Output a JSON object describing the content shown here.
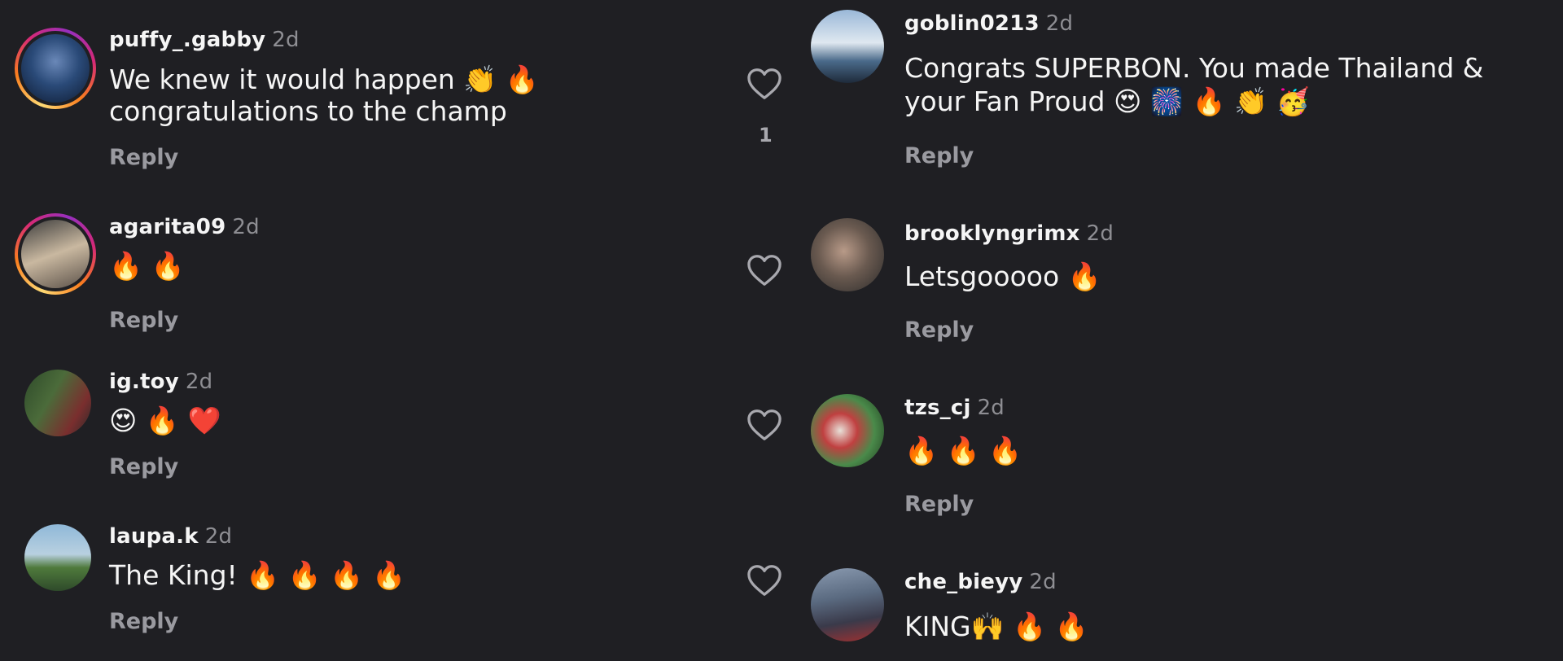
{
  "comments_left": [
    {
      "username": "puffy_.gabby",
      "time": "2d",
      "line1": "We knew it would happen 👏 🔥",
      "line2": "congratulations to the champ",
      "reply": "Reply",
      "avatar_colors": [
        "#2a4a78",
        "#0e1a30"
      ]
    },
    {
      "username": "agarita09",
      "time": "2d",
      "line1": "🔥 🔥",
      "line2": "",
      "reply": "Reply",
      "avatar_colors": [
        "#c9b8a0",
        "#3b3b3b"
      ]
    },
    {
      "username": "ig.toy",
      "time": "2d",
      "line1": "😍 🔥 ❤️",
      "line2": "",
      "reply": "Reply",
      "avatar_colors": [
        "#4b6b3a",
        "#7a2e2e"
      ]
    },
    {
      "username": "laupa.k",
      "time": "2d",
      "line1": "The King! 🔥 🔥 🔥 🔥",
      "line2": "",
      "reply": "Reply",
      "avatar_colors": [
        "#8fb8d8",
        "#4f7a3c"
      ]
    }
  ],
  "comments_right": [
    {
      "username": "goblin0213",
      "time": "2d",
      "line1": "Congrats SUPERBON. You made Thailand &",
      "line2": "your Fan Proud 😍 🎆 🔥 👏 🥳",
      "reply": "Reply",
      "likes": "1",
      "avatar_colors": [
        "#dfe8f0",
        "#4a6a8a"
      ]
    },
    {
      "username": "brooklyngrimx",
      "time": "2d",
      "line1": "Letsgooooo 🔥",
      "line2": "",
      "reply": "Reply",
      "likes": "",
      "avatar_colors": [
        "#6a5a50",
        "#2a2a2a"
      ]
    },
    {
      "username": "tzs_cj",
      "time": "2d",
      "line1": "🔥 🔥 🔥",
      "line2": "",
      "reply": "Reply",
      "likes": "",
      "avatar_colors": [
        "#4a8a4a",
        "#e8e0d8"
      ]
    },
    {
      "username": "che_bieyy",
      "time": "2d",
      "line1": "KING🙌 🔥 🔥",
      "line2": "",
      "reply": "Reply",
      "likes": "",
      "avatar_colors": [
        "#8a9ab0",
        "#3a3a4a"
      ]
    }
  ],
  "colors": {
    "background": "#1f1f23",
    "text": "#f5f5f5",
    "muted": "#8e8e93",
    "reply": "#9a9aa0"
  },
  "icons": {
    "like": "heart-outline-icon"
  }
}
